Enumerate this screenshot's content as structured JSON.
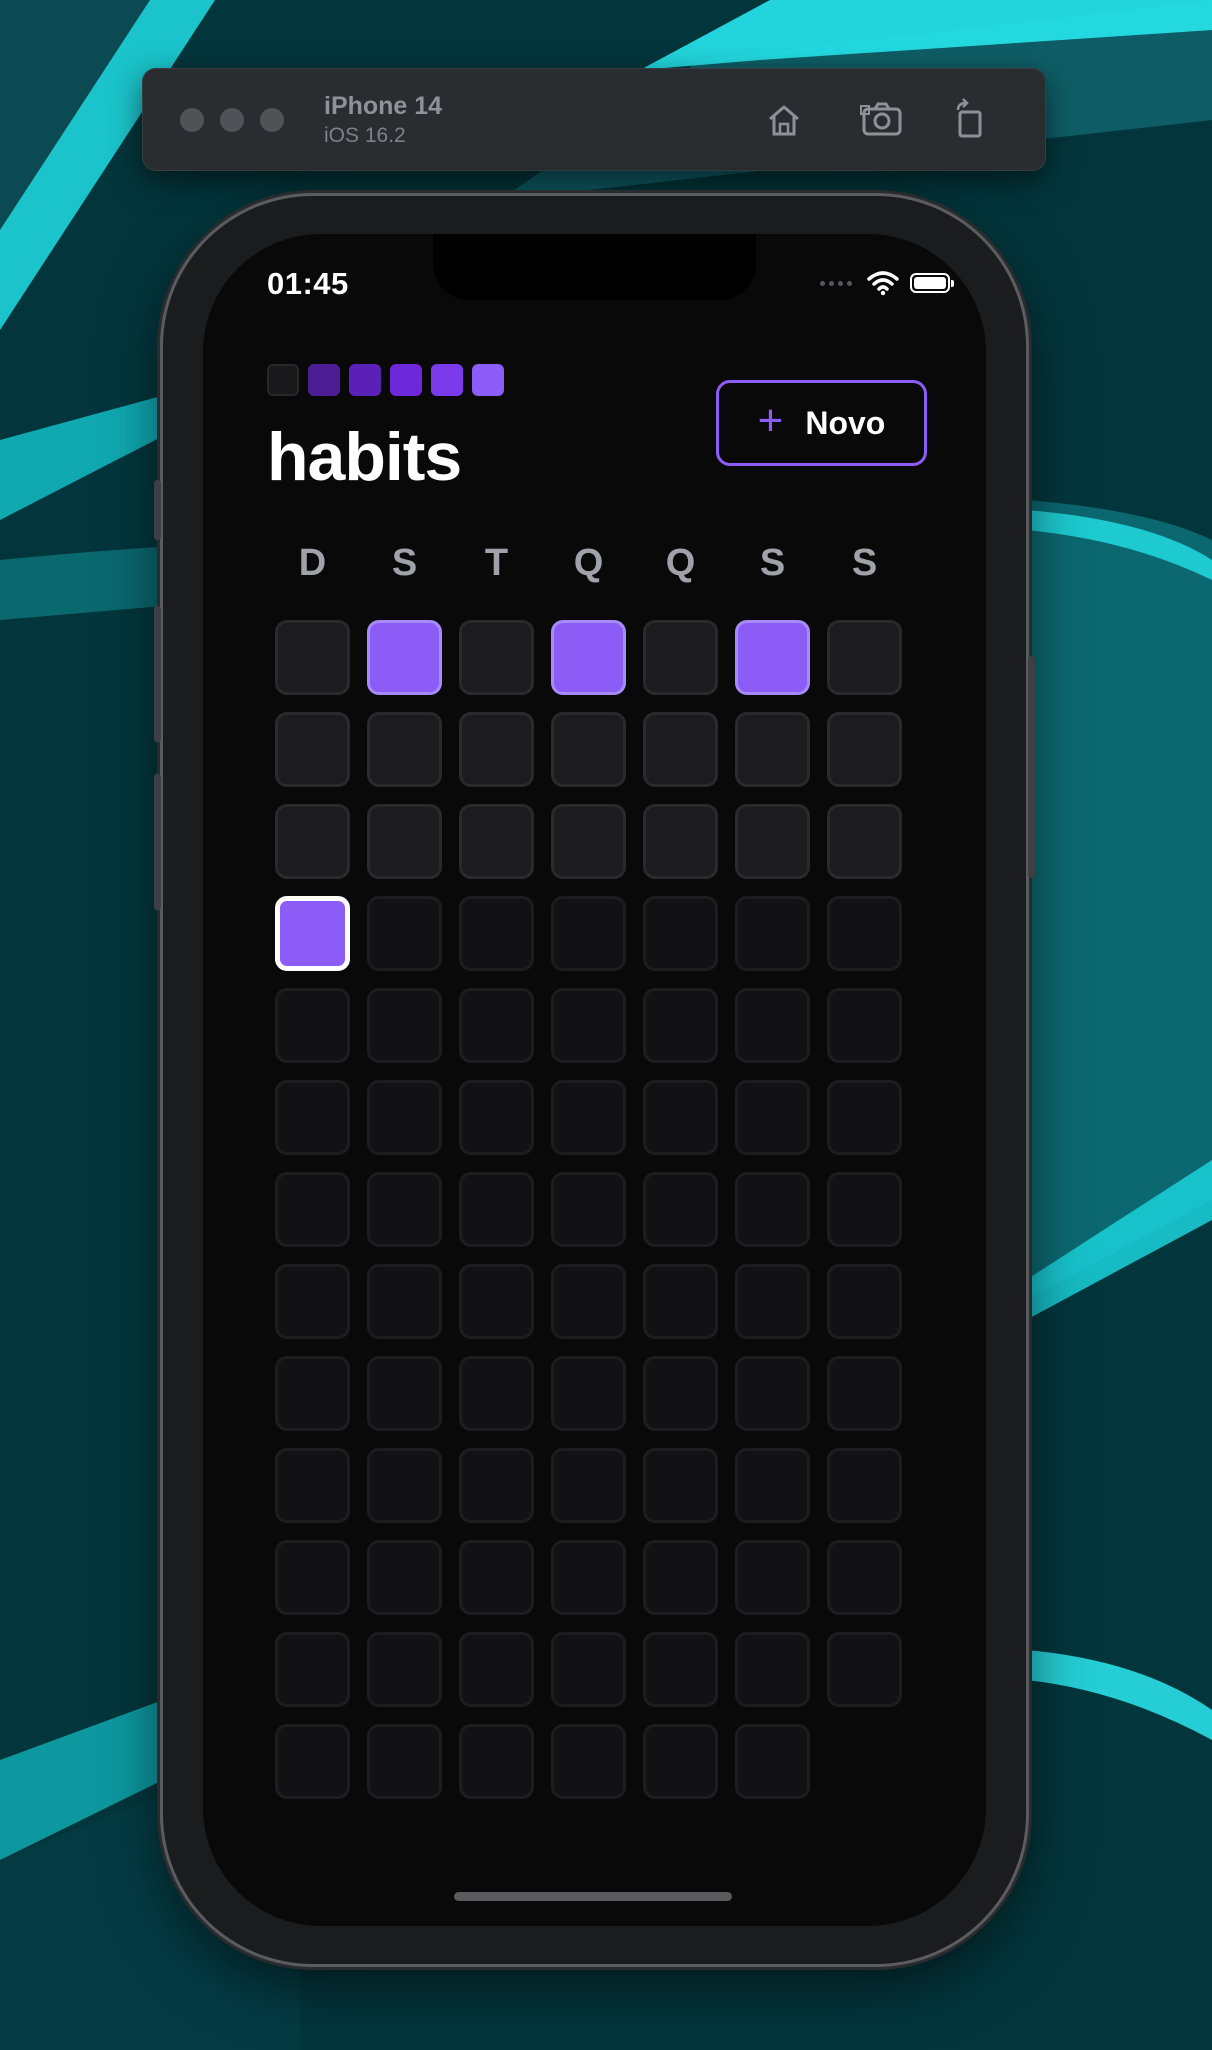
{
  "simulator": {
    "device_name": "iPhone 14",
    "os_version": "iOS 16.2",
    "buttons": [
      "home-icon",
      "screenshot-icon",
      "rotate-icon"
    ]
  },
  "status_bar": {
    "time": "01:45",
    "icons": [
      "signal-icon",
      "wifi-icon",
      "battery-icon"
    ]
  },
  "app": {
    "title": "habits",
    "logo_colors": [
      "#18181b",
      "#4c1d95",
      "#5b21b6",
      "#6d28d9",
      "#7c3aed",
      "#8b5cf6"
    ],
    "new_button": {
      "icon": "plus-icon",
      "label": "Novo"
    },
    "week_days": [
      "D",
      "S",
      "T",
      "Q",
      "Q",
      "S",
      "S"
    ],
    "summary": {
      "rows": [
        [
          "past",
          "done",
          "past",
          "done",
          "past",
          "done",
          "past"
        ],
        [
          "past",
          "past",
          "past",
          "past",
          "past",
          "past",
          "past"
        ],
        [
          "past",
          "past",
          "past",
          "past",
          "past",
          "past",
          "past"
        ],
        [
          "today",
          "future",
          "future",
          "future",
          "future",
          "future",
          "future"
        ],
        [
          "future",
          "future",
          "future",
          "future",
          "future",
          "future",
          "future"
        ],
        [
          "future",
          "future",
          "future",
          "future",
          "future",
          "future",
          "future"
        ],
        [
          "future",
          "future",
          "future",
          "future",
          "future",
          "future",
          "future"
        ],
        [
          "future",
          "future",
          "future",
          "future",
          "future",
          "future",
          "future"
        ],
        [
          "future",
          "future",
          "future",
          "future",
          "future",
          "future",
          "future"
        ],
        [
          "future",
          "future",
          "future",
          "future",
          "future",
          "future",
          "future"
        ],
        [
          "future",
          "future",
          "future",
          "future",
          "future",
          "future",
          "future"
        ],
        [
          "future",
          "future",
          "future",
          "future",
          "future",
          "future",
          "future"
        ],
        [
          "future",
          "future",
          "future",
          "future",
          "future",
          "future",
          "blank"
        ]
      ]
    }
  },
  "colors": {
    "accent": "#8b5cf6",
    "background": "#09090a",
    "cell": "#1c1c1f"
  }
}
